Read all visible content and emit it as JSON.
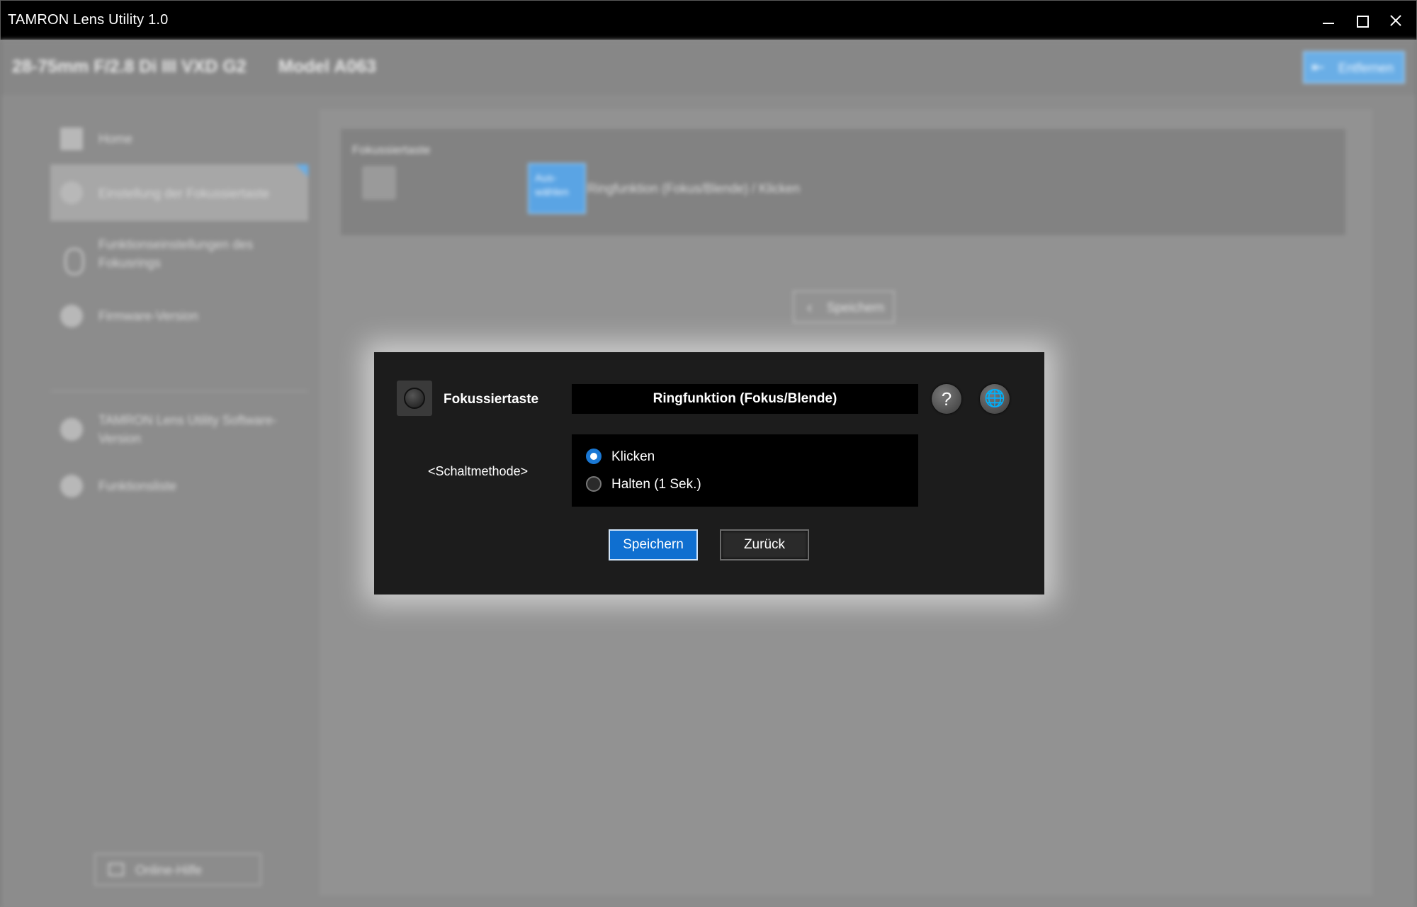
{
  "window": {
    "title": "TAMRON Lens Utility 1.0"
  },
  "lens_bar": {
    "lens_name": "28-75mm F/2.8 Di III VXD G2",
    "model": "Model A063",
    "remove_button": "Entfernen"
  },
  "sidebar": {
    "items": [
      {
        "label": "Home"
      },
      {
        "label": "Einstellung der Fokussiertaste"
      },
      {
        "label": "Funktionseinstellungen des Fokusrings"
      },
      {
        "label": "Firmware-Version"
      },
      {
        "label": "TAMRON Lens Utility Software-Version"
      },
      {
        "label": "Funktionsliste"
      }
    ],
    "online_help": "Online-Hilfe"
  },
  "main": {
    "panel_label": "Fokussiertaste",
    "select_button": "Aus-wählen",
    "current_function": "Ringfunktion (Fokus/Blende)  / Klicken",
    "save_button": "Speichern"
  },
  "dialog": {
    "title": "Fokussiertaste",
    "function": "Ringfunktion (Fokus/Blende)",
    "method_label": "<Schaltmethode>",
    "options": [
      {
        "label": "Klicken",
        "selected": true
      },
      {
        "label": "Halten (1 Sek.)",
        "selected": false
      }
    ],
    "save_button": "Speichern",
    "back_button": "Zurück",
    "help_icon": "?",
    "globe_icon": "🌐"
  },
  "colors": {
    "accent": "#0f6fd0",
    "dialog_bg": "#1c1c1c"
  }
}
